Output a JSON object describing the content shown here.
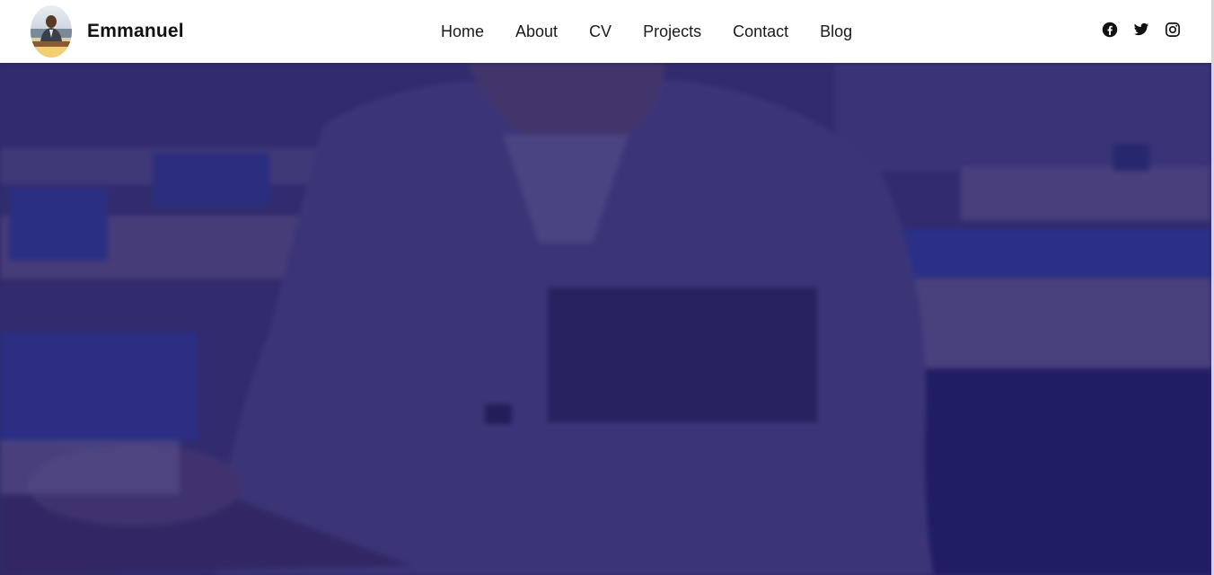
{
  "brand": {
    "name": "Emmanuel",
    "avatar_icon": "profile-photo"
  },
  "nav": {
    "items": [
      {
        "label": "Home"
      },
      {
        "label": "About"
      },
      {
        "label": "CV"
      },
      {
        "label": "Projects"
      },
      {
        "label": "Contact"
      },
      {
        "label": "Blog"
      }
    ]
  },
  "socials": [
    {
      "icon": "facebook-icon"
    },
    {
      "icon": "twitter-icon"
    },
    {
      "icon": "instagram-icon"
    }
  ],
  "colors": {
    "navbar_bg": "#ffffff",
    "hero_overlay": "#2c246e",
    "text": "#111111"
  }
}
